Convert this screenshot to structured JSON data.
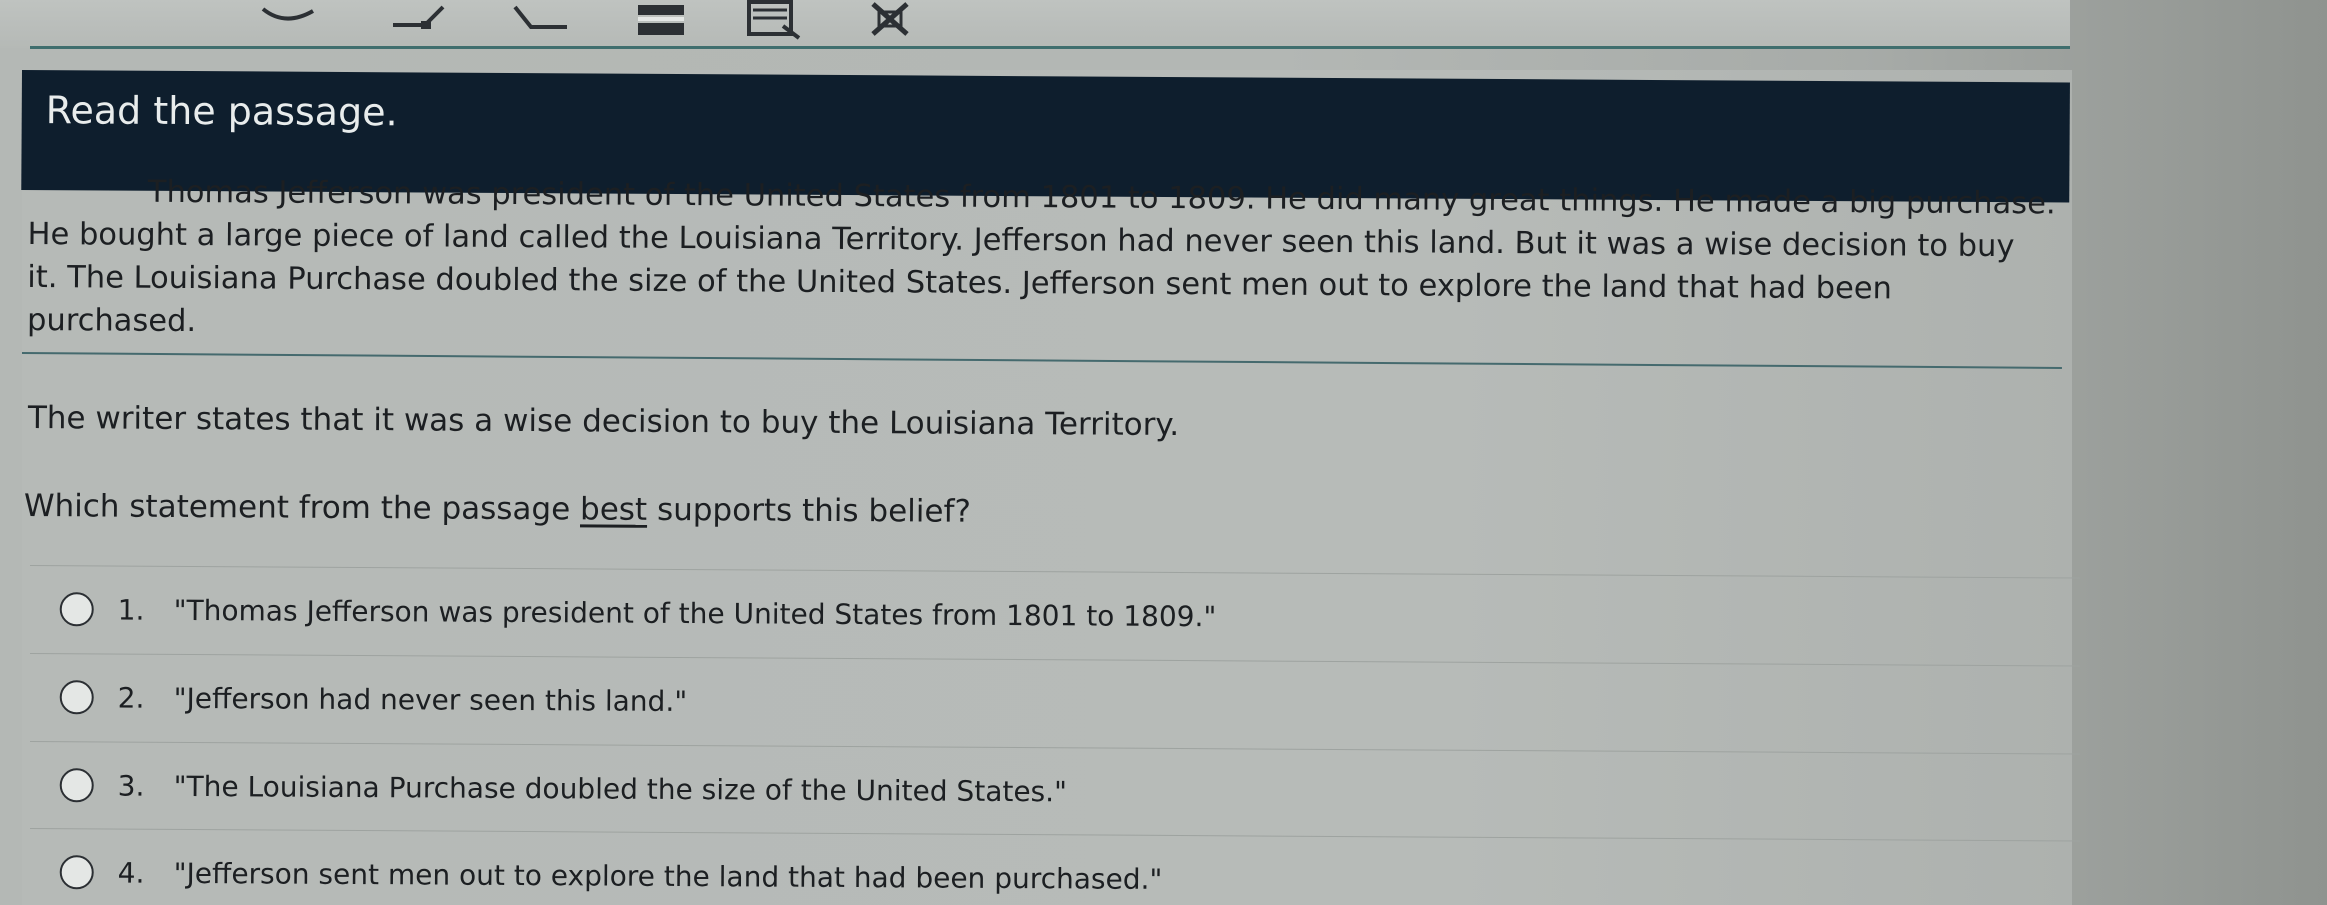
{
  "toolbar": {
    "tools": [
      {
        "name": "undo-icon"
      },
      {
        "name": "pencil-icon"
      },
      {
        "name": "highlighter-icon"
      },
      {
        "name": "line-reader-icon"
      },
      {
        "name": "notepad-icon"
      },
      {
        "name": "answer-eliminator-icon"
      }
    ]
  },
  "header": {
    "title": "Read the passage."
  },
  "passage": {
    "line1": "Thomas Jefferson was president of the United States from 1801 to 1809. He did many great things. He made a big purchase.",
    "line2": "He bought a large piece of land called the Louisiana Territory. Jefferson had never seen this land. But it was a wise decision to buy",
    "line3": "it. The Louisiana Purchase doubled the size of the United States. Jefferson sent men out to explore the land that had been",
    "line4": "purchased."
  },
  "question": {
    "stem": "The writer states that it was a wise decision to buy the Louisiana Territory.",
    "prompt_before": "Which statement from the passage ",
    "prompt_emphasis": "best",
    "prompt_after": " supports this belief?"
  },
  "options": [
    {
      "number": "1.",
      "text": "\"Thomas Jefferson was president of the United States from 1801 to 1809.\""
    },
    {
      "number": "2.",
      "text": "\"Jefferson had never seen this land.\""
    },
    {
      "number": "3.",
      "text": "\"The Louisiana Purchase doubled the size of the United States.\""
    },
    {
      "number": "4.",
      "text": "\"Jefferson sent men out to explore the land that had been purchased.\""
    }
  ],
  "colors": {
    "header_bg": "#0e1e2d",
    "rule": "#456a6e",
    "text": "#1c1f22"
  }
}
